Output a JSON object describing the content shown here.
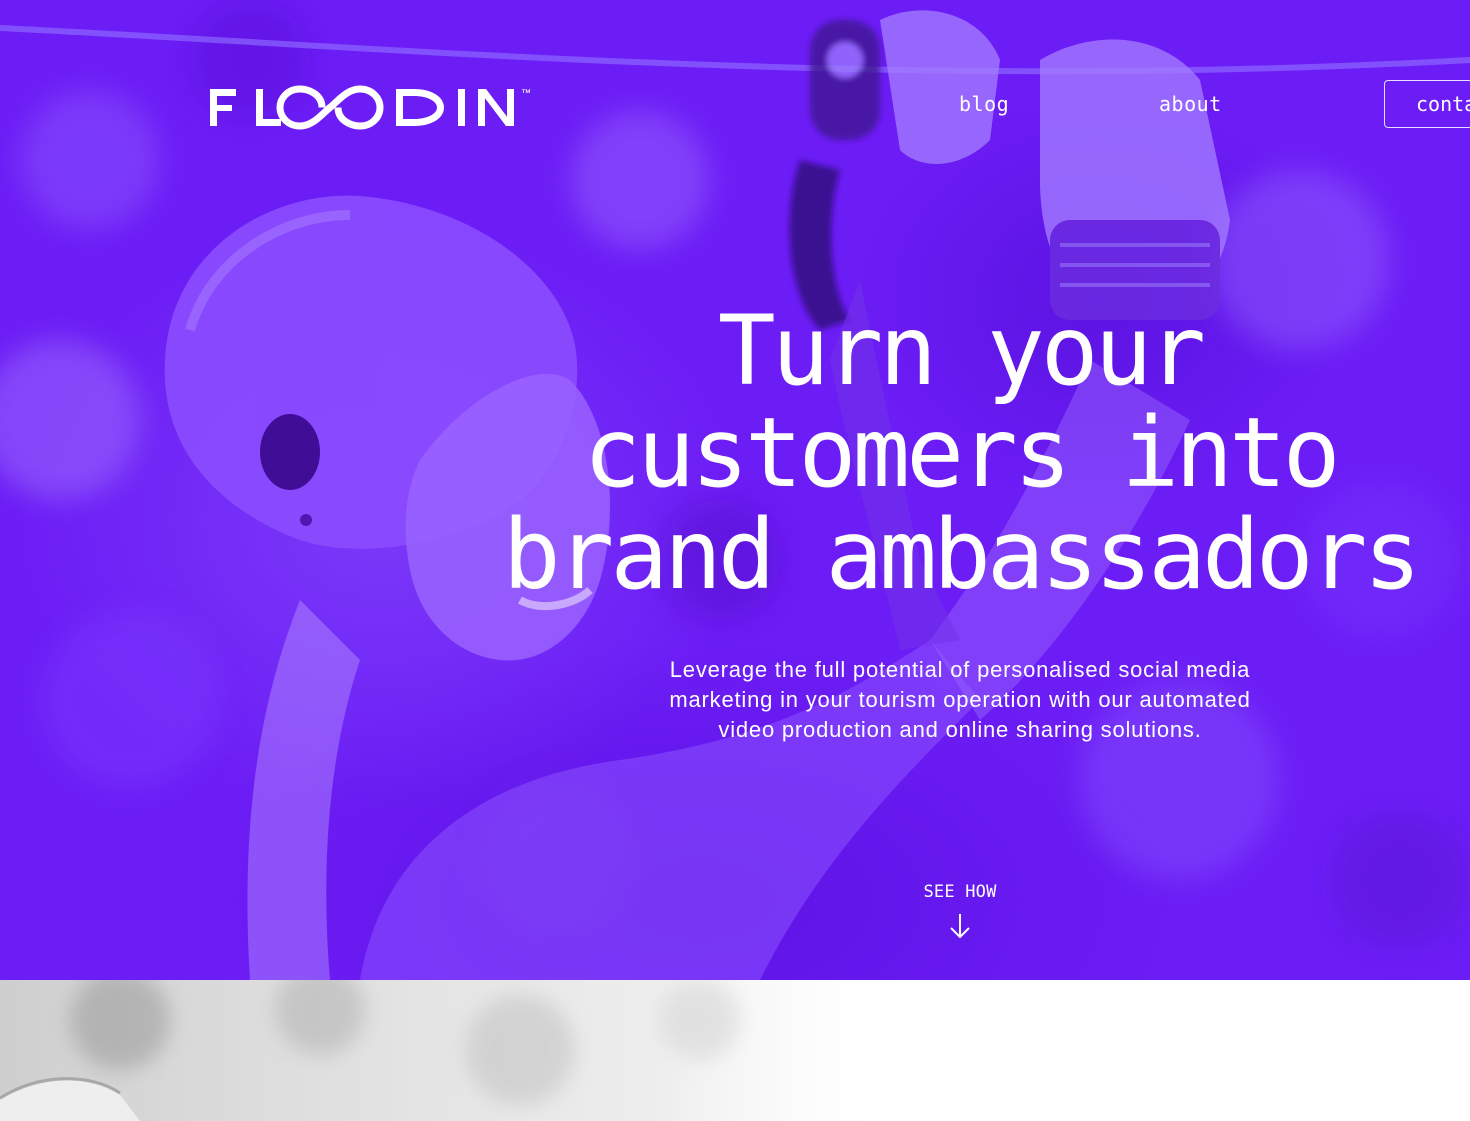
{
  "brand": {
    "logo_text": "FLOODIN",
    "trademark": "™",
    "accent_color": "#6c1df5"
  },
  "nav": {
    "blog_label": "blog",
    "about_label": "about",
    "contact_label": "contact"
  },
  "hero": {
    "headline_lines": [
      "Turn your",
      "customers into",
      "brand ambassadors"
    ],
    "subline_lines": [
      "Leverage the full potential of personalised social media",
      "marketing in your tourism operation with our automated",
      "video production and online sharing solutions."
    ],
    "cta_label": "SEE HOW",
    "cta_icon": "arrow-down-icon",
    "background_image": "woman-in-helmet-on-zipline-photo"
  },
  "lower_section": {
    "background_image": "grayscale-photo-faded"
  }
}
